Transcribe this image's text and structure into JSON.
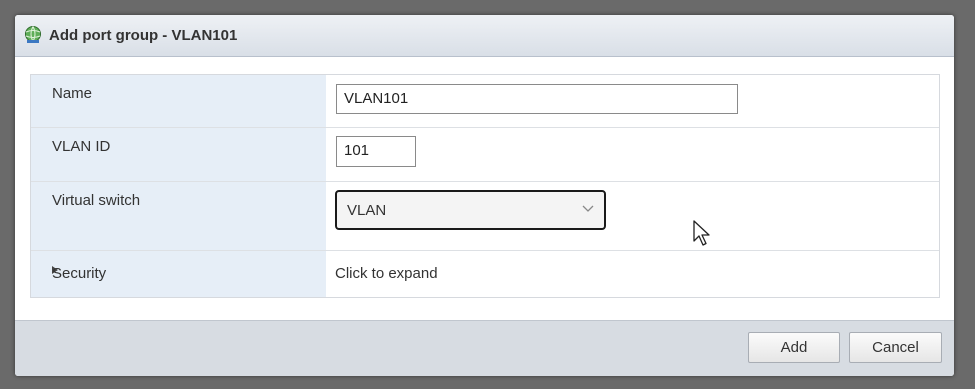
{
  "dialog": {
    "title": "Add port group - VLAN101"
  },
  "form": {
    "name_label": "Name",
    "name_value": "VLAN101",
    "vlan_label": "VLAN ID",
    "vlan_value": "101",
    "switch_label": "Virtual switch",
    "switch_value": "VLAN",
    "security_label": "Security",
    "security_value": "Click to expand"
  },
  "buttons": {
    "add": "Add",
    "cancel": "Cancel"
  },
  "icons": {
    "title_icon": "network-globe-icon",
    "dropdown": "chevron-down-icon",
    "expander": "triangle-right-icon",
    "cursor": "mouse-pointer-icon"
  }
}
